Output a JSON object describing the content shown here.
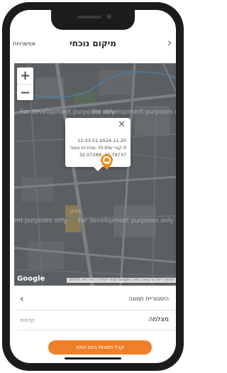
{
  "header": {
    "title": "מיקום נוכחי",
    "options_label": "אפשרויות",
    "back_icon": "chevron-right-icon"
  },
  "map": {
    "zoom_in_label": "+",
    "zoom_out_label": "−",
    "watermark": "For development purposes only",
    "logo": "Google",
    "attribution": "קיצורי מקלדת | נתוני מפה ©2024 Google | תנאים | דיווח על שגיאה במפה",
    "street_label": "ביגרון",
    "popup": {
      "timestamp": "2024-11-20 12:33:51",
      "speed_line": "0 קמ״ש(0.0) :מהירות טאור",
      "coordinates": "34.79737, 32.07269",
      "close_icon": "close-icon"
    },
    "marker_icon": "car-marker-icon",
    "colors": {
      "map_bg": "#5b5f62",
      "road": "#7c8084",
      "block": "#6a6e71",
      "marker": "#f08b1e"
    }
  },
  "history": {
    "label": "היסטוריית תמונה",
    "chevron_icon": "chevron-left-icon"
  },
  "camera": {
    "name": "מצלמה",
    "value": "קדמית"
  },
  "cta": {
    "label": "קבל תמונות בזמן אמת",
    "color": "#f07f29"
  }
}
